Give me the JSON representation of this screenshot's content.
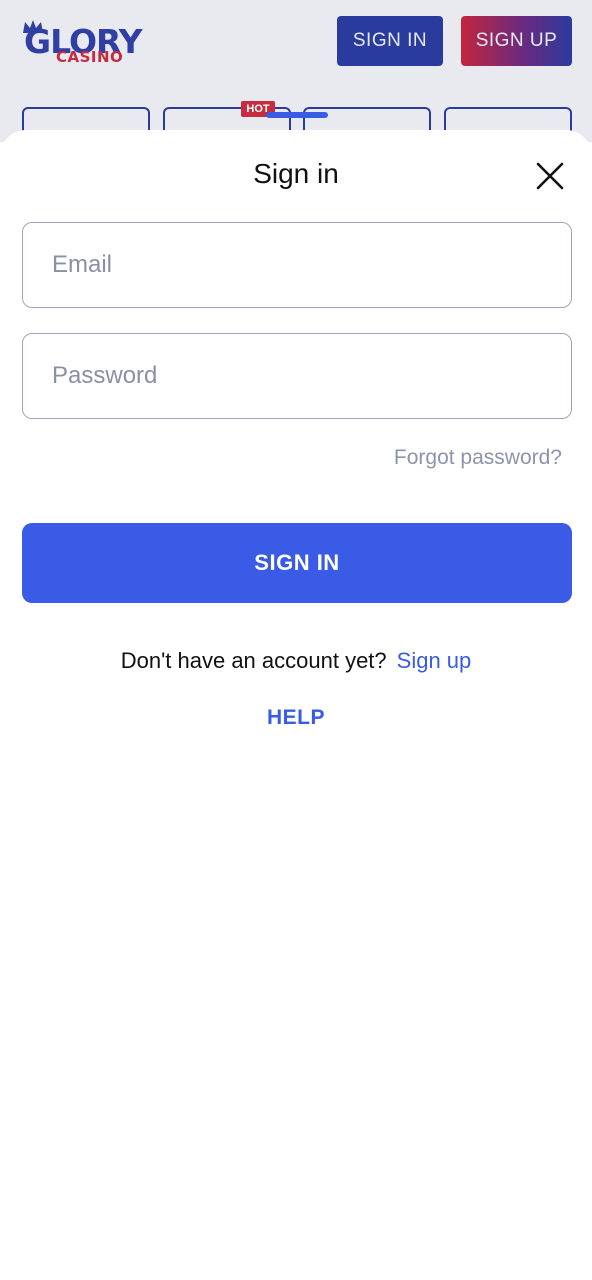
{
  "header": {
    "logo_main": "GLORY",
    "logo_sub": "CASINO",
    "signin_label": "SIGN IN",
    "signup_label": "SIGN UP"
  },
  "tabs": {
    "hot_badge": "HOT"
  },
  "modal": {
    "title": "Sign in",
    "email_placeholder": "Email",
    "password_placeholder": "Password",
    "forgot_label": "Forgot password?",
    "submit_label": "SIGN IN",
    "no_account_text": "Don't have an account yet?",
    "signup_link": "Sign up",
    "help_label": "HELP"
  },
  "colors": {
    "accent": "#3a5be6",
    "brand_blue": "#2a3b9e",
    "brand_red": "#c62b3e",
    "backdrop": "#e9eaf0"
  },
  "icons": {
    "close": "close-icon",
    "crown": "crown-icon"
  }
}
